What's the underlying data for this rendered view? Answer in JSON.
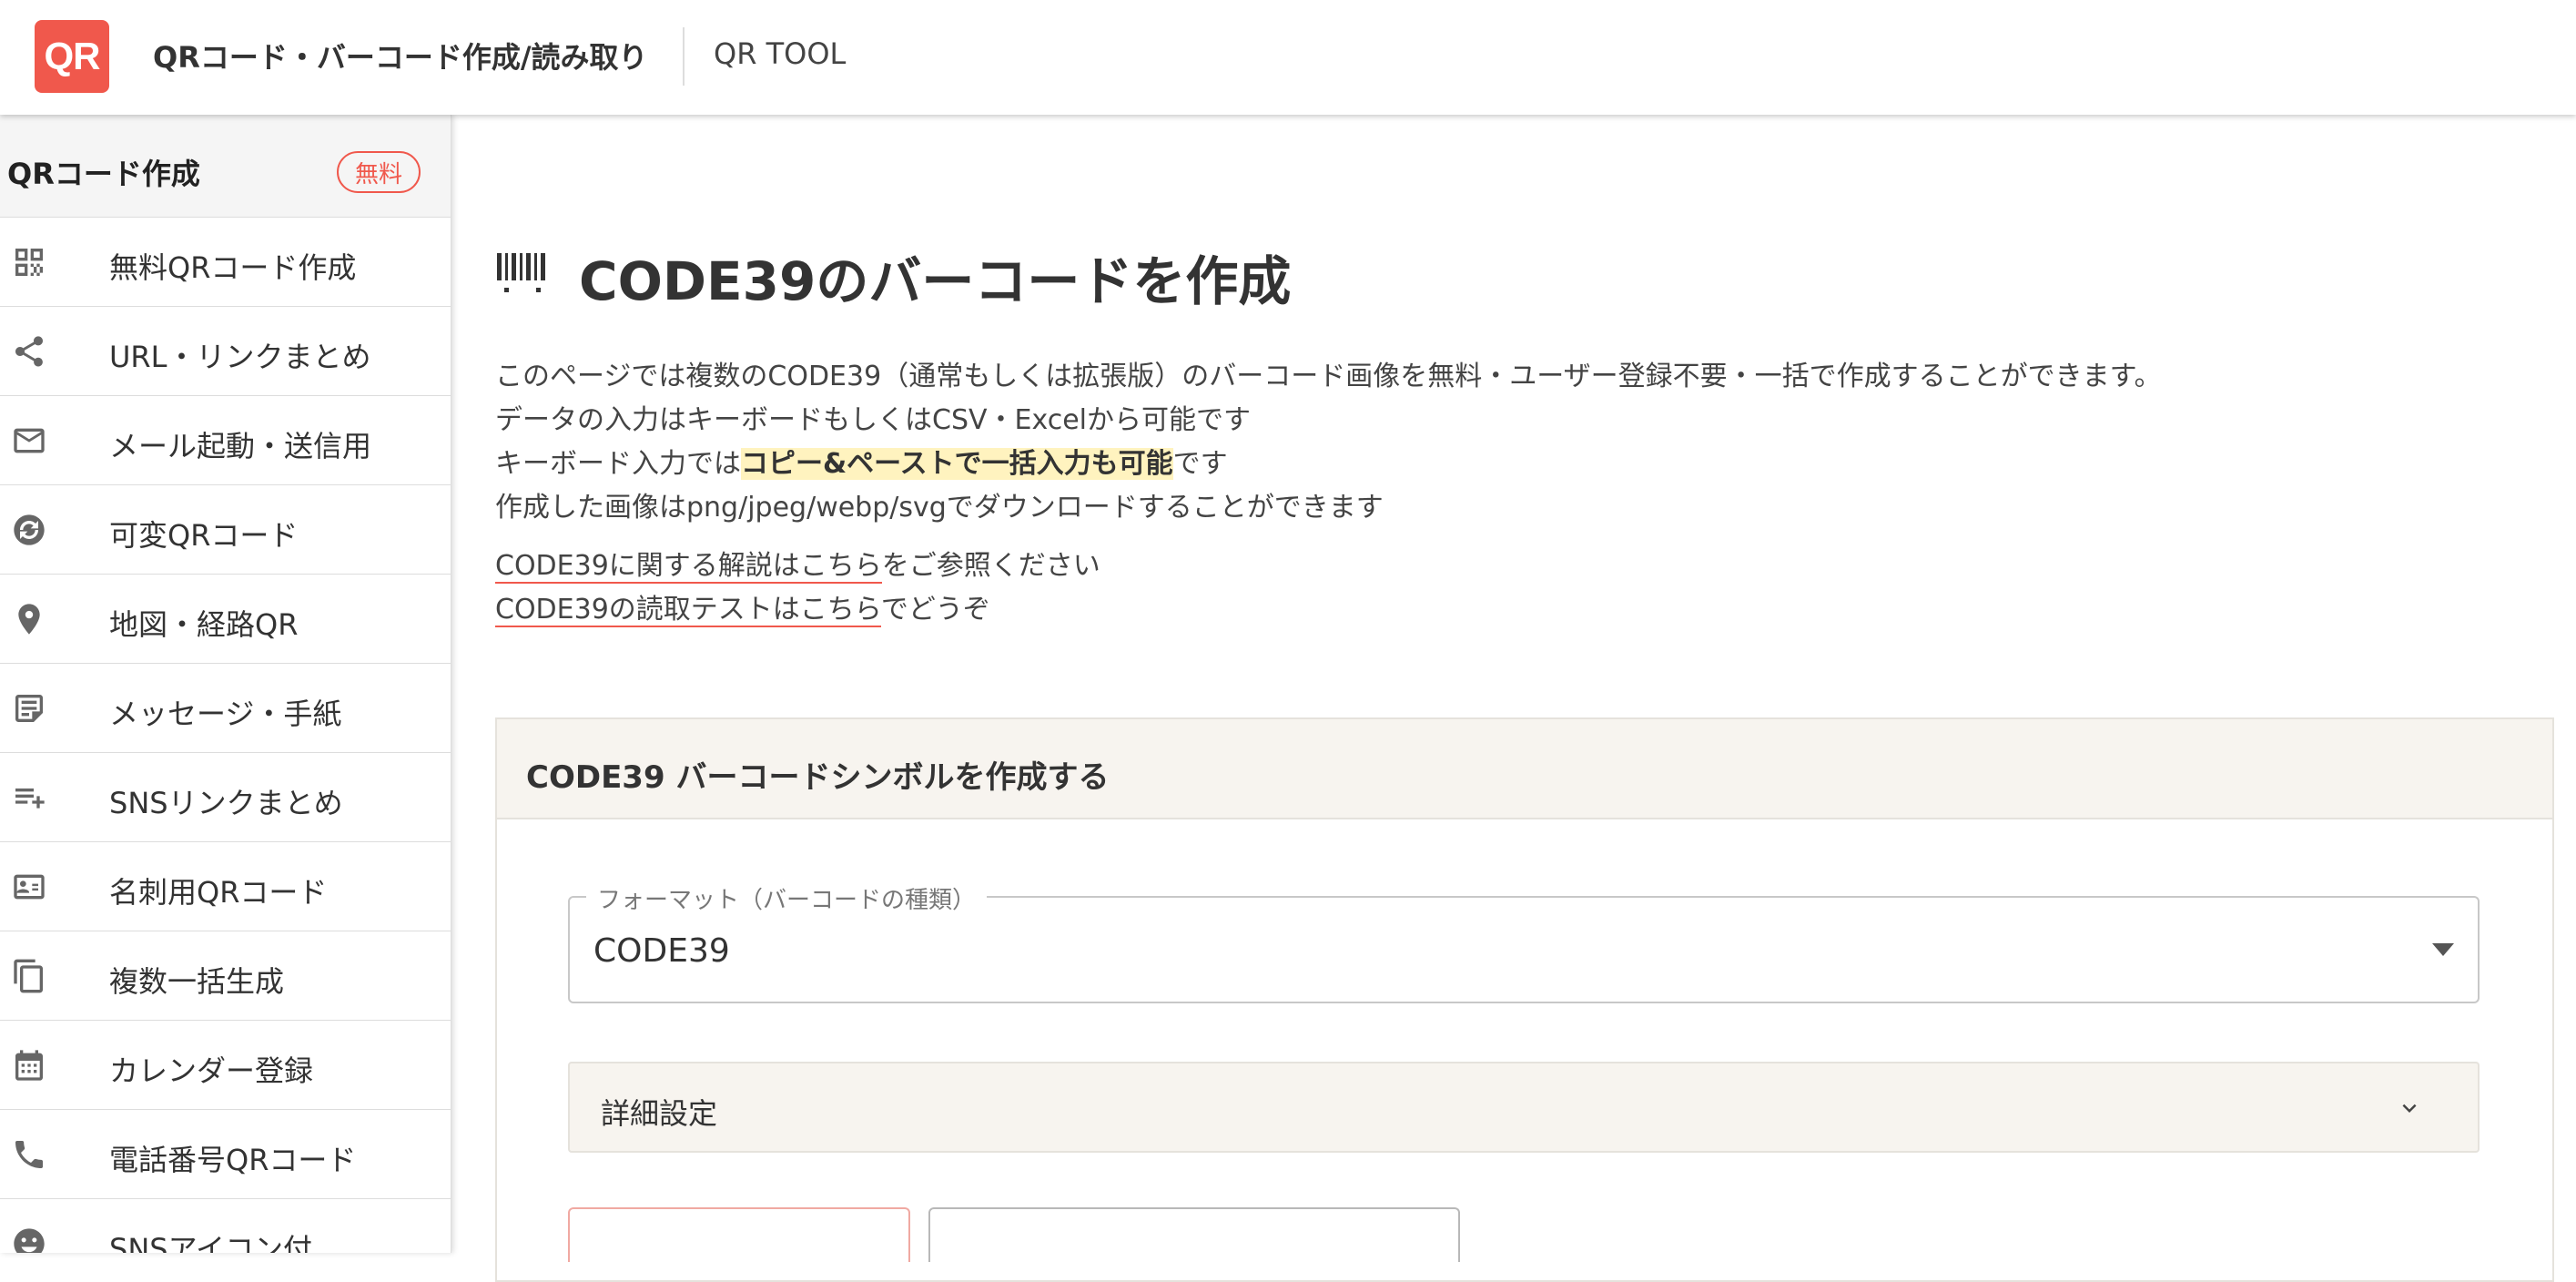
{
  "header": {
    "logo_text": "QR",
    "site_title": "QRコード・バーコード作成/読み取り",
    "sub_title": "QR TOOL"
  },
  "sidebar": {
    "header_title": "QRコード作成",
    "badge": "無料",
    "items": [
      {
        "label": "無料QRコード作成",
        "icon": "qr-code-icon"
      },
      {
        "label": "URL・リンクまとめ",
        "icon": "share-icon"
      },
      {
        "label": "メール起動・送信用",
        "icon": "mail-icon"
      },
      {
        "label": "可変QRコード",
        "icon": "refresh-circle-icon"
      },
      {
        "label": "地図・経路QR",
        "icon": "map-pin-icon"
      },
      {
        "label": "メッセージ・手紙",
        "icon": "note-icon"
      },
      {
        "label": "SNSリンクまとめ",
        "icon": "playlist-add-icon"
      },
      {
        "label": "名刺用QRコード",
        "icon": "contact-card-icon"
      },
      {
        "label": "複数一括生成",
        "icon": "copy-icon"
      },
      {
        "label": "カレンダー登録",
        "icon": "calendar-icon"
      },
      {
        "label": "電話番号QRコード",
        "icon": "phone-icon"
      },
      {
        "label": "SNSアイコン付",
        "icon": "smiley-icon"
      }
    ]
  },
  "main": {
    "title": "CODE39のバーコードを作成",
    "desc_line1": "このページでは複数のCODE39（通常もしくは拡張版）のバーコード画像を無料・ユーザー登録不要・一括で作成することができます。",
    "desc_line2": "データの入力はキーボードもしくはCSV・Excelから可能です",
    "desc_line3_prefix": "キーボード入力では",
    "desc_line3_highlight": "コピー&ペーストで一括入力も可能",
    "desc_line3_suffix": "です",
    "desc_line4": "作成した画像はpng/jpeg/webp/svgでダウンロードすることができます",
    "link1_text": "CODE39に関する解説はこちら",
    "link1_suffix": "をご参照ください",
    "link2_text": "CODE39の読取テストはこちら",
    "link2_suffix": "でどうぞ"
  },
  "card": {
    "title": "CODE39 バーコードシンボルを作成する",
    "format_label": "フォーマット（バーコードの種類）",
    "format_value": "CODE39",
    "accordion_label": "詳細設定"
  },
  "colors": {
    "accent": "#f0584c",
    "highlight": "#fff3bf",
    "card_header": "#f7f4ef"
  }
}
